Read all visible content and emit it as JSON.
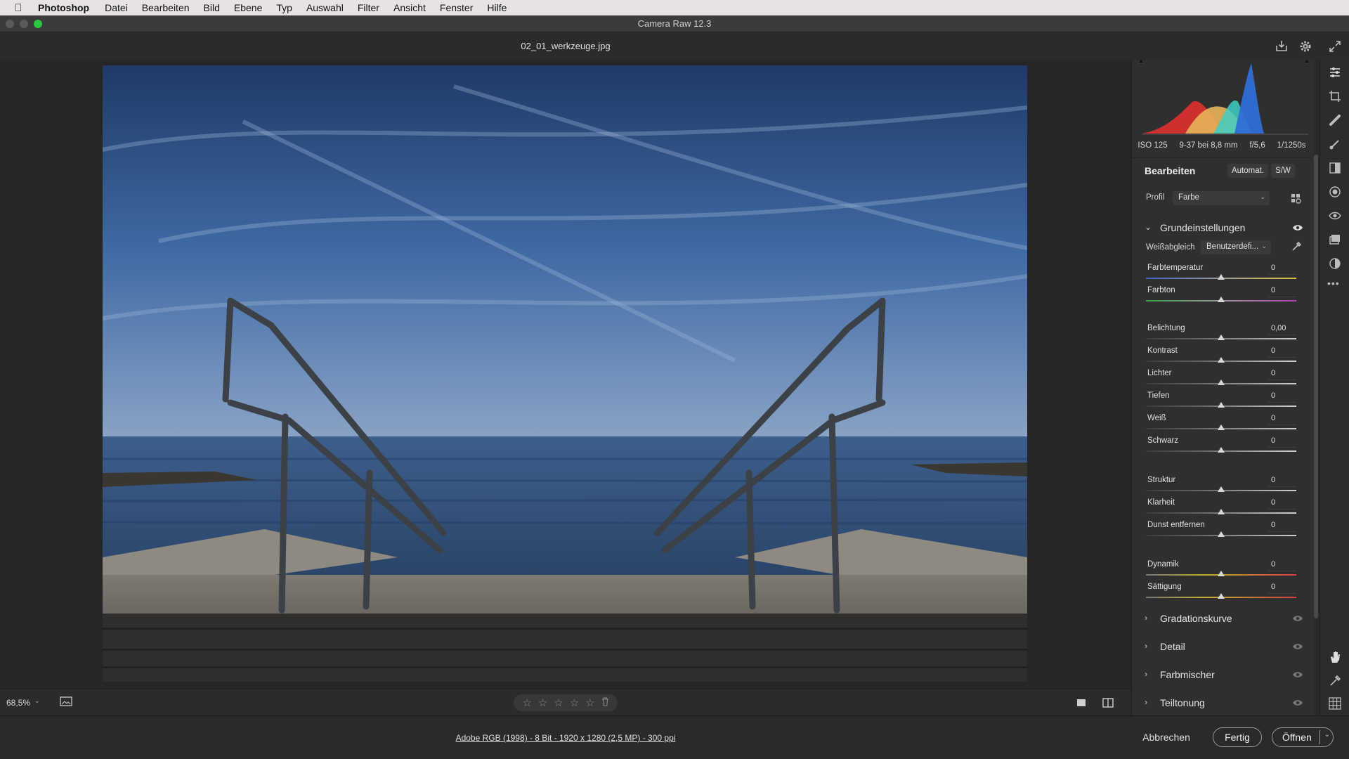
{
  "menubar": {
    "app": "Photoshop",
    "items": [
      "Datei",
      "Bearbeiten",
      "Bild",
      "Ebene",
      "Typ",
      "Auswahl",
      "Filter",
      "Ansicht",
      "Fenster",
      "Hilfe"
    ]
  },
  "window": {
    "title": "Camera Raw 12.3"
  },
  "toolbar": {
    "filename": "02_01_werkzeuge.jpg"
  },
  "canvas": {
    "zoom": "68,5%"
  },
  "panel": {
    "exif": {
      "iso": "ISO 125",
      "lens": "9-37 bei 8,8 mm",
      "aperture": "f/5,6",
      "shutter": "1/1250s"
    },
    "edit_title": "Bearbeiten",
    "auto_label": "Automat.",
    "bw_label": "S/W",
    "profile_label": "Profil",
    "profile_value": "Farbe",
    "basic_title": "Grundeinstellungen",
    "wb_label": "Weißabgleich",
    "wb_value": "Benutzerdefi...",
    "sliders": [
      {
        "label": "Farbtemperatur",
        "value": "0",
        "level": 0.5
      },
      {
        "label": "Farbton",
        "value": "0",
        "level": 0.5
      },
      {
        "label": "Belichtung",
        "value": "0,00",
        "level": 0.5
      },
      {
        "label": "Kontrast",
        "value": "0",
        "level": 0.5
      },
      {
        "label": "Lichter",
        "value": "0",
        "level": 0.5
      },
      {
        "label": "Tiefen",
        "value": "0",
        "level": 0.5
      },
      {
        "label": "Weiß",
        "value": "0",
        "level": 0.5
      },
      {
        "label": "Schwarz",
        "value": "0",
        "level": 0.5
      },
      {
        "label": "Struktur",
        "value": "0",
        "level": 0.5
      },
      {
        "label": "Klarheit",
        "value": "0",
        "level": 0.5
      },
      {
        "label": "Dunst entfernen",
        "value": "0",
        "level": 0.5
      },
      {
        "label": "Dynamik",
        "value": "0",
        "level": 0.5
      },
      {
        "label": "Sättigung",
        "value": "0",
        "level": 0.5
      }
    ],
    "sections": [
      "Gradationskurve",
      "Detail",
      "Farbmischer",
      "Teiltonung"
    ]
  },
  "footer": {
    "workflow": "Adobe RGB (1998) - 8 Bit - 1920 x 1280 (2,5 MP) - 300 ppi",
    "cancel": "Abbrechen",
    "done": "Fertig",
    "open": "Öffnen"
  },
  "colors": {
    "traffic_zoom": "#2dc440",
    "panel_bg": "#2f2f2f",
    "canvas_bg": "#262626"
  }
}
